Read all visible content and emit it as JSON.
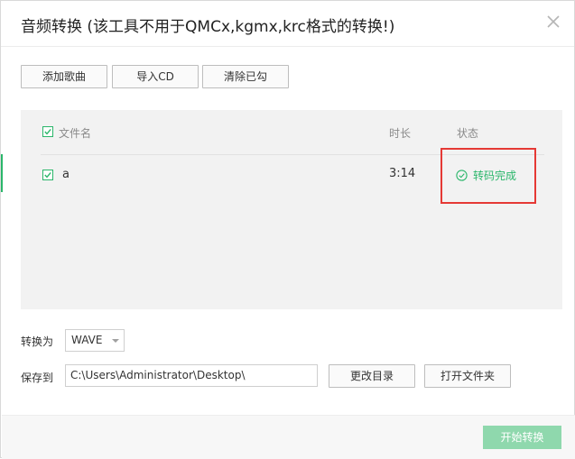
{
  "dialog": {
    "title": "音频转换 (该工具不用于QMCx,kgmx,krc格式的转换!)"
  },
  "toolbar": {
    "add_label": "添加歌曲",
    "import_label": "导入CD",
    "clear_label": "清除已勾"
  },
  "table": {
    "columns": [
      "文件名",
      "时长",
      "状态"
    ],
    "rows": [
      {
        "name": "a",
        "duration": "3:14",
        "status": "转码完成",
        "checked": true
      }
    ],
    "header_checked": true
  },
  "options": {
    "convert_label": "转换为",
    "format_value": "WAVE",
    "save_label": "保存到",
    "save_path": "C:\\Users\\Administrator\\Desktop\\",
    "change_dir_label": "更改目录",
    "open_folder_label": "打开文件夹"
  },
  "footer": {
    "start_label": "开始转换"
  },
  "colors": {
    "accent": "#2ab66a",
    "highlight": "#e53935",
    "start_button": "#8fd8ad"
  }
}
